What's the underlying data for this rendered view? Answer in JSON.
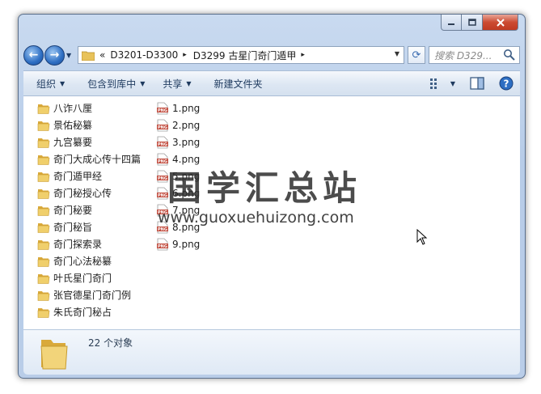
{
  "window": {
    "controls": {
      "minimize": "minimize-icon",
      "maximize": "maximize-icon",
      "close": "close-icon"
    }
  },
  "nav": {
    "back_icon": "back-arrow-icon",
    "forward_icon": "forward-arrow-icon",
    "breadcrumb": {
      "overflow": "«",
      "items": [
        "D3201-D3300",
        "D3299 古星门奇门遁甲"
      ]
    },
    "search_placeholder": "搜索 D329..."
  },
  "toolbar": {
    "organize": "组织",
    "include_in_library": "包含到库中",
    "share": "共享",
    "new_folder": "新建文件夹"
  },
  "folders": [
    "八诈八厘",
    "景佑秘纂",
    "九宫纂要",
    "奇门大成心传十四篇",
    "奇门遁甲经",
    "奇门秘授心传",
    "奇门秘要",
    "奇门秘旨",
    "奇门探索录",
    "奇门心法秘纂",
    "叶氏星门奇门",
    "张官德星门奇门例",
    "朱氏奇门秘占"
  ],
  "files": [
    "1.png",
    "2.png",
    "3.png",
    "4.png",
    "5.png",
    "6.png",
    "7.png",
    "8.png",
    "9.png"
  ],
  "file_icon_label": "PNG",
  "details": {
    "count_text": "22 个对象"
  },
  "watermark": {
    "cn": "国学汇总站",
    "en": "www.guoxuehuizong.com"
  },
  "colors": {
    "accent": "#2d6ec3",
    "folder": "#e8c25a",
    "close": "#c03a22"
  }
}
